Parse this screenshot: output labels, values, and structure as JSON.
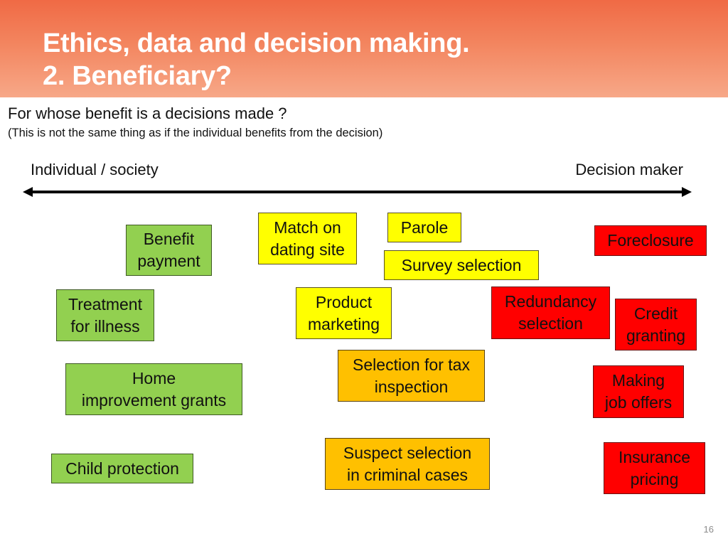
{
  "header": {
    "title_line1": "Ethics, data and decision making.",
    "title_line2": "2. Beneficiary?"
  },
  "question": {
    "main": "For whose benefit is a decisions made ?",
    "note": "(This is not the same thing as if the individual benefits from the decision)"
  },
  "axis": {
    "left_label": "Individual / society",
    "right_label": "Decision maker",
    "arrow": "double-headed-arrow"
  },
  "colors": {
    "individual": "#92d050",
    "neutral": "#ffff00",
    "state": "#ffc000",
    "decision_maker": "#ff0000"
  },
  "boxes": [
    {
      "id": "benefit-payment",
      "label": "Benefit\npayment",
      "category": "green"
    },
    {
      "id": "treatment-for-illness",
      "label": "Treatment\nfor illness",
      "category": "green"
    },
    {
      "id": "home-improvement-grants",
      "label": "Home\nimprovement grants",
      "category": "green"
    },
    {
      "id": "child-protection",
      "label": "Child protection",
      "category": "green"
    },
    {
      "id": "match-on-dating-site",
      "label": "Match on\ndating site",
      "category": "yellow"
    },
    {
      "id": "parole",
      "label": "Parole",
      "category": "yellow"
    },
    {
      "id": "survey-selection",
      "label": "Survey selection",
      "category": "yellow"
    },
    {
      "id": "product-marketing",
      "label": "Product\nmarketing",
      "category": "yellow"
    },
    {
      "id": "selection-for-tax-inspection",
      "label": "Selection for tax\ninspection",
      "category": "orange"
    },
    {
      "id": "suspect-selection",
      "label": "Suspect selection\nin criminal cases",
      "category": "orange"
    },
    {
      "id": "foreclosure",
      "label": "Foreclosure",
      "category": "red"
    },
    {
      "id": "redundancy-selection",
      "label": "Redundancy\nselection",
      "category": "red"
    },
    {
      "id": "credit-granting",
      "label": "Credit\ngranting",
      "category": "red"
    },
    {
      "id": "making-job-offers",
      "label": "Making\njob offers",
      "category": "red"
    },
    {
      "id": "insurance-pricing",
      "label": "Insurance\npricing",
      "category": "red"
    }
  ],
  "footer": {
    "page_number": "16"
  }
}
